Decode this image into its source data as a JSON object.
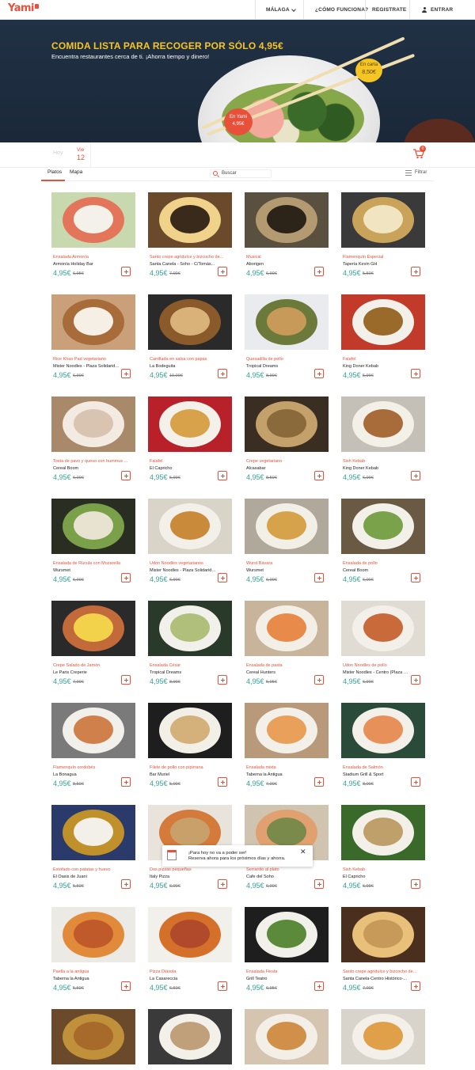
{
  "header": {
    "logo": "Yami",
    "city": "MÁLAGA",
    "how": "¿CÓMO FUNCIONA?",
    "register": "REGISTRATE",
    "login": "ENTRAR"
  },
  "hero": {
    "title": "COMIDA LISTA PARA RECOGER POR SÓLO 4,95€",
    "subtitle": "Encuentra restaurantes cerca de ti. ¡Ahorra tiempo y dinero!",
    "carta_label": "En carta",
    "carta_price": "8,50€",
    "yami_label": "En Yami",
    "yami_price": "4,95€"
  },
  "datebar": {
    "today": "Hoy",
    "day_name": "Vie",
    "day_num": "12",
    "cart_count": "0"
  },
  "tabs": {
    "dishes": "Platos",
    "map": "Mapa"
  },
  "search": {
    "placeholder": "Buscar"
  },
  "filter": {
    "label": "Filtrar"
  },
  "products": [
    {
      "name": "Ensalada Armonía",
      "restaurant": "Armonía Holiday Bar",
      "price": "4,95€",
      "old": "6,95€"
    },
    {
      "name": "Santo crepe agridulce y bizcocho de...",
      "restaurant": "Santa Canela - Soho - C/Tomás...",
      "price": "4,95€",
      "old": "7,00€"
    },
    {
      "name": "Musical",
      "restaurant": "Aborigen",
      "price": "4,95€",
      "old": "6,90€"
    },
    {
      "name": "Flamenquín Especial",
      "restaurant": "Tapería Kevin GH",
      "price": "4,95€",
      "old": "5,50€"
    },
    {
      "name": "Rice Khao Pad vegetariano",
      "restaurant": "Mister Noodles - Plaza Solidarida...",
      "price": "4,95€",
      "old": "6,90€"
    },
    {
      "name": "Carrillada en salsa con papas",
      "restaurant": "La Bodeguita",
      "price": "4,95€",
      "old": "10,00€"
    },
    {
      "name": "Quesadilla de pollo",
      "restaurant": "Tropical Dreams",
      "price": "4,95€",
      "old": "8,90€"
    },
    {
      "name": "Falafel",
      "restaurant": "King Doner Kebab",
      "price": "4,95€",
      "old": "5,99€"
    },
    {
      "name": "Tosta de pavo y queso con hummus ...",
      "restaurant": "Cereal Boom",
      "price": "4,95€",
      "old": "6,00€"
    },
    {
      "name": "Falafel",
      "restaurant": "El Capricho",
      "price": "4,95€",
      "old": "5,99€"
    },
    {
      "name": "Crepe vegetariano",
      "restaurant": "Alcasabar",
      "price": "4,95€",
      "old": "8,50€"
    },
    {
      "name": "Sish Kebab",
      "restaurant": "King Doner Kebab",
      "price": "4,95€",
      "old": "6,99€"
    },
    {
      "name": "Ensalada de Rúcula con Mozarella",
      "restaurant": "Wursmet",
      "price": "4,95€",
      "old": "6,00€"
    },
    {
      "name": "Udon Noodles vegetarianos",
      "restaurant": "Mister Noodles - Plaza Solidarida...",
      "price": "4,95€",
      "old": "6,90€"
    },
    {
      "name": "Wurst Bávara",
      "restaurant": "Wursmet",
      "price": "4,95€",
      "old": "6,00€"
    },
    {
      "name": "Ensalada de pollo",
      "restaurant": "Cereal Boom",
      "price": "4,95€",
      "old": "6,00€"
    },
    {
      "name": "Crepe Salado de Jamón",
      "restaurant": "Le Paris Creperie",
      "price": "4,95€",
      "old": "7,90€"
    },
    {
      "name": "Ensalada César",
      "restaurant": "Tropical Dreams",
      "price": "4,95€",
      "old": "8,90€"
    },
    {
      "name": "Ensalada de pasta",
      "restaurant": "Cereal Hunters",
      "price": "4,95€",
      "old": "5,95€"
    },
    {
      "name": "Udon Noodles de pollo",
      "restaurant": "Mister Noodles - Centro (Plaza de...",
      "price": "4,95€",
      "old": "6,90€"
    },
    {
      "name": "Flamenquín cordobés",
      "restaurant": "La Bonagua",
      "price": "4,95€",
      "old": "8,50€"
    },
    {
      "name": "Filete de pollo con pipirrana",
      "restaurant": "Bar Muriel",
      "price": "4,95€",
      "old": "5,00€"
    },
    {
      "name": "Ensalada mixta",
      "restaurant": "Taberna la Antigua",
      "price": "4,95€",
      "old": "7,00€"
    },
    {
      "name": "Ensalada de Salmón",
      "restaurant": "Stadium Grill & Sport",
      "price": "4,95€",
      "old": "8,00€"
    },
    {
      "name": "Estofado con patatas y huevo",
      "restaurant": "El Oasis de Juani",
      "price": "4,95€",
      "old": "5,50€"
    },
    {
      "name": "Dos pizzas pequeñas",
      "restaurant": "Italy Pizza",
      "price": "4,95€",
      "old": "6,00€"
    },
    {
      "name": "Serranito al plato",
      "restaurant": "Cafe del Soho",
      "price": "4,95€",
      "old": "6,00€"
    },
    {
      "name": "Sish Kebab",
      "restaurant": "El Capricho",
      "price": "4,95€",
      "old": "6,99€"
    },
    {
      "name": "Paella a la antigua",
      "restaurant": "Taberna la Antigua",
      "price": "4,95€",
      "old": "5,50€"
    },
    {
      "name": "Pizza Diávola",
      "restaurant": "La Casareccia",
      "price": "4,95€",
      "old": "6,50€"
    },
    {
      "name": "Ensalada Fiesta",
      "restaurant": "Grill Teatro",
      "price": "4,95€",
      "old": "6,95€"
    },
    {
      "name": "Santo crepe agridulce y bizcocho de...",
      "restaurant": "Santa Canela-Centro Histórico-...",
      "price": "4,95€",
      "old": "7,00€"
    },
    {
      "name": "",
      "restaurant": "",
      "price": "",
      "old": ""
    },
    {
      "name": "",
      "restaurant": "",
      "price": "",
      "old": ""
    },
    {
      "name": "",
      "restaurant": "",
      "price": "",
      "old": ""
    },
    {
      "name": "",
      "restaurant": "",
      "price": "",
      "old": ""
    }
  ],
  "toast": {
    "line1": "¡Para hoy no va a poder ser!",
    "line2": "Reserva ahora para los próximos días y ahorra."
  },
  "colors": {
    "brand": "#e8503a",
    "price": "#35a59a",
    "hero_bg": "#213145",
    "hero_title": "#f5c623"
  }
}
